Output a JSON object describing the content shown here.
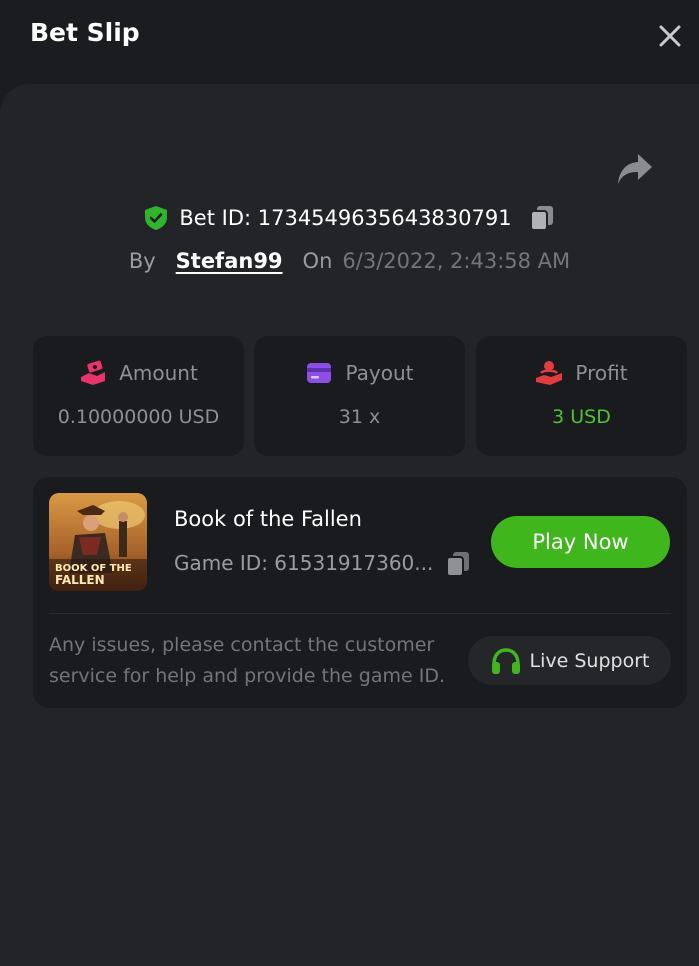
{
  "header": {
    "title": "Bet Slip"
  },
  "bet": {
    "id_text": "Bet ID: 1734549635643830791",
    "by_label": "By",
    "username": "Stefan99",
    "on_label": "On",
    "datetime": "6/3/2022, 2:43:58 AM"
  },
  "stats": [
    {
      "label": "Amount",
      "value": "0.10000000 USD",
      "icon": "money-hand-icon"
    },
    {
      "label": "Payout",
      "value": "31 x",
      "icon": "wallet-icon"
    },
    {
      "label": "Profit",
      "value": "3 USD",
      "icon": "profit-hand-icon"
    }
  ],
  "game": {
    "name": "Book of the Fallen",
    "id_text": "Game ID: 61531917360...",
    "thumb_text_line1": "BOOK OF THE",
    "thumb_text_line2": "FALLEN",
    "play_label": "Play Now"
  },
  "support": {
    "message": "Any issues, please contact the customer service for help and provide the game ID.",
    "button_label": "Live Support"
  },
  "colors": {
    "accent_green": "#3fb71c",
    "profit_green": "#4cc42a",
    "amount_icon": "#e8336b",
    "payout_icon": "#8b4fe6",
    "profit_icon": "#e23c3c"
  }
}
